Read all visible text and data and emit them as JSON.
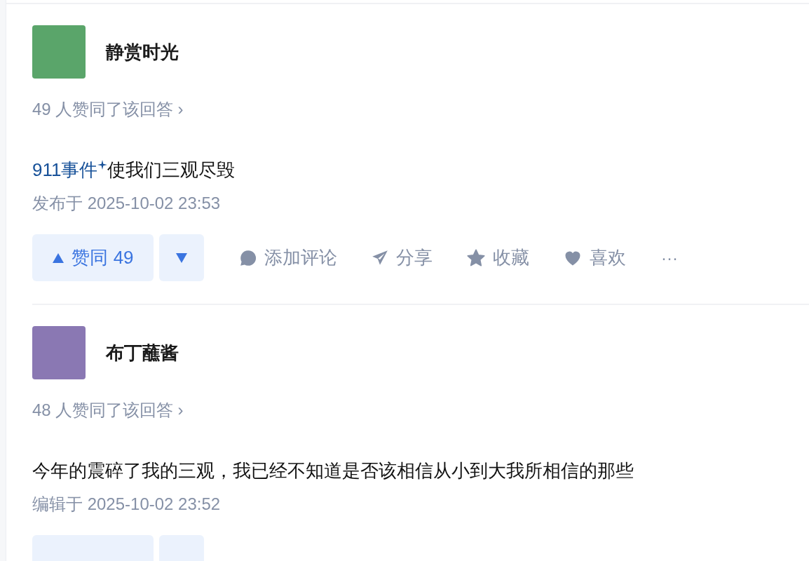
{
  "answers": [
    {
      "author": "静赏时光",
      "color": "#5aa56a",
      "upvote_summary": "49 人赞同了该回答",
      "summary_arrow": "›",
      "content": [
        {
          "kind": "link",
          "text": "911事件"
        },
        {
          "kind": "text",
          "text": "使我们三观尽毁"
        }
      ],
      "timestamp": "发布于 2025-10-02 23:53",
      "action_bar": {
        "kind": "full",
        "upvote": "赞同 49",
        "actions": [
          {
            "kind": "comment",
            "label": "添加评论"
          },
          {
            "kind": "share",
            "label": "分享"
          },
          {
            "kind": "star",
            "label": "收藏"
          },
          {
            "kind": "heart",
            "label": "喜欢"
          }
        ],
        "more": "···"
      }
    },
    {
      "author": "布丁蘸酱",
      "color": "#8a78b3",
      "upvote_summary": "48 人赞同了该回答",
      "summary_arrow": "›",
      "content": [
        {
          "kind": "text",
          "text": "今年的震碎了我的三观，我已经不知道是否该相信从小到大我所相信的那些"
        }
      ],
      "timestamp": "编辑于 2025-10-02 23:52",
      "action_bar": {
        "kind": "cut"
      }
    }
  ]
}
